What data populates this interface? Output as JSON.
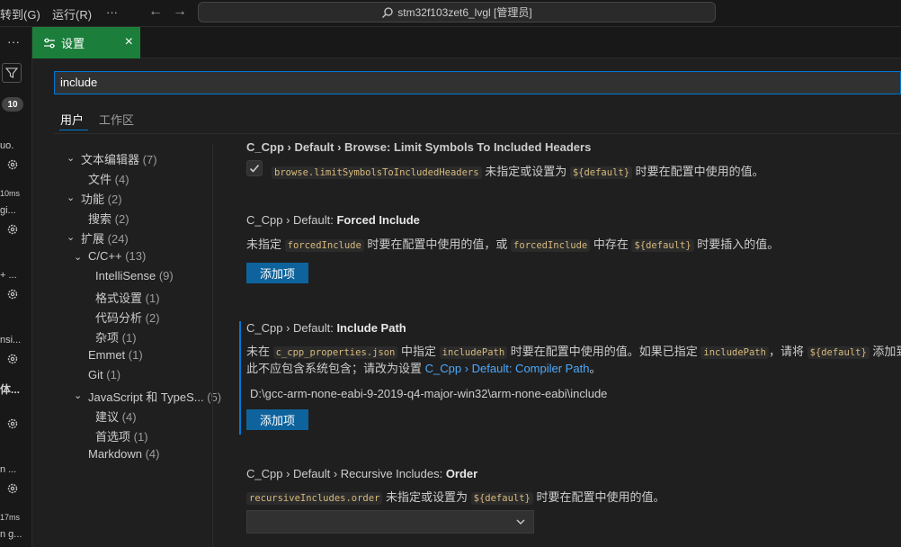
{
  "titlebar": {
    "menu_goto": "转到(G)",
    "menu_run": "运行(R)",
    "menu_more": "···",
    "nav_back": "←",
    "nav_forward": "→",
    "window_title": "stm32f103zet6_lvgl [管理员]"
  },
  "activity": {
    "more": "···",
    "badge": "10",
    "texts": [
      "uo.",
      "10ms",
      "gi...",
      "+ ...",
      "nsi...",
      "体...",
      "n ...",
      "17ms",
      "n g..."
    ]
  },
  "tab": {
    "label": "设置",
    "close": "×"
  },
  "search": {
    "value": "include"
  },
  "scope": {
    "user": "用户",
    "workspace": "工作区"
  },
  "toc": [
    {
      "label": "文本编辑器",
      "count": "(7)",
      "expanded": true
    },
    {
      "label": "文件",
      "count": "(4)"
    },
    {
      "label": "功能",
      "count": "(2)",
      "expanded": true
    },
    {
      "label": "搜索",
      "count": "(2)"
    },
    {
      "label": "扩展",
      "count": "(24)",
      "expanded": true
    },
    {
      "label": "C/C++",
      "count": "(13)",
      "expanded": true
    },
    {
      "label": "IntelliSense",
      "count": "(9)"
    },
    {
      "label": "格式设置",
      "count": "(1)"
    },
    {
      "label": "代码分析",
      "count": "(2)"
    },
    {
      "label": "杂项",
      "count": "(1)"
    },
    {
      "label": "Emmet",
      "count": "(1)"
    },
    {
      "label": "Git",
      "count": "(1)"
    },
    {
      "label": "JavaScript 和 TypeS...",
      "count": "(5)",
      "expanded": true
    },
    {
      "label": "建议",
      "count": "(4)"
    },
    {
      "label": "首选项",
      "count": "(1)"
    },
    {
      "label": "Markdown",
      "count": "(4)"
    }
  ],
  "settings": {
    "limit_symbols": {
      "header": "C_Cpp › Default › Browse: Limit Symbols To Included Headers",
      "code": "browse.limitSymbolsToIncludedHeaders",
      "desc": " 未指定或设置为 ",
      "code2": "${default}",
      "desc2": " 时要在配置中使用的值。",
      "checked": true
    },
    "forced_include": {
      "title_prefix": "C_Cpp › Default: ",
      "title_name": "Forced Include",
      "desc1": "未指定 ",
      "code1": "forcedInclude",
      "desc2": " 时要在配置中使用的值，或 ",
      "code2": "forcedInclude",
      "desc3": " 中存在 ",
      "code3": "${default}",
      "desc4": " 时要插入的值。",
      "button": "添加项"
    },
    "include_path": {
      "title_prefix": "C_Cpp › Default: ",
      "title_name": "Include Path",
      "desc1": "未在 ",
      "code1": "c_cpp_properties.json",
      "desc2": " 中指定 ",
      "code2": "includePath",
      "desc3": " 时要在配置中使用的值。如果已指定 ",
      "code3": "includePath",
      "desc4": "，请将 ",
      "code4": "${default}",
      "desc5": " 添加到数",
      "line2": "此不应包含系统包含；请改为设置 ",
      "link": "C_Cpp › Default: Compiler Path",
      "line2_end": "。",
      "value": "D:\\gcc-arm-none-eabi-9-2019-q4-major-win32\\arm-none-eabi\\include",
      "button": "添加项"
    },
    "recursive": {
      "title_prefix": "C_Cpp › Default › Recursive Includes: ",
      "title_name": "Order",
      "code1": "recursiveIncludes.order",
      "desc1": " 未指定或设置为 ",
      "code2": "${default}",
      "desc2": " 时要在配置中使用的值。",
      "selected": ""
    }
  },
  "colors": {
    "accent": "#0078d4",
    "tab_bg": "#1b7f3b",
    "button_bg": "#0e639c",
    "link": "#4daafc"
  }
}
